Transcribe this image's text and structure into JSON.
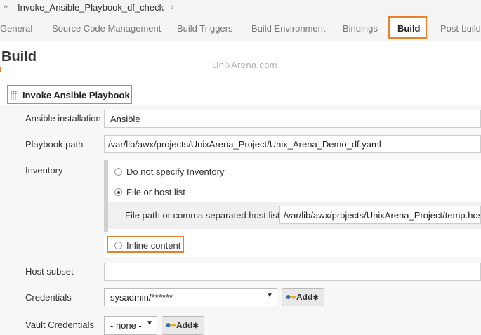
{
  "breadcrumb": {
    "separator": "»",
    "job_name": "Invoke_Ansible_Playbook_df_check",
    "chevron": "›"
  },
  "tabs": [
    {
      "label": "General",
      "active": false
    },
    {
      "label": "Source Code Management",
      "active": false
    },
    {
      "label": "Build Triggers",
      "active": false
    },
    {
      "label": "Build Environment",
      "active": false
    },
    {
      "label": "Bindings",
      "active": false
    },
    {
      "label": "Build",
      "active": true
    },
    {
      "label": "Post-build",
      "active": false
    }
  ],
  "page_title": "Build",
  "watermark": "UnixArena.com",
  "section": {
    "title": "Invoke Ansible Playbook"
  },
  "form": {
    "ansible_installation": {
      "label": "Ansible installation",
      "value": "Ansible"
    },
    "playbook_path": {
      "label": "Playbook path",
      "value": "/var/lib/awx/projects/UnixArena_Project/Unix_Arena_Demo_df.yaml"
    },
    "inventory": {
      "label": "Inventory",
      "options": [
        {
          "label": "Do not specify Inventory",
          "selected": false
        },
        {
          "label": "File or host list",
          "selected": true
        },
        {
          "label": "Inline content",
          "selected": false
        }
      ],
      "file_path_label": "File path or comma separated host list",
      "file_path_value": "/var/lib/awx/projects/UnixArena_Project/temp.hosts"
    },
    "host_subset": {
      "label": "Host subset",
      "value": ""
    },
    "credentials": {
      "label": "Credentials",
      "value": "sysadmin/******",
      "add_label": "Add"
    },
    "vault_credentials": {
      "label": "Vault Credentials",
      "value": "- none -",
      "add_label": "Add"
    }
  },
  "colors": {
    "highlight": "#e8822a",
    "tab_bar": "#f5f5f5",
    "section_bg": "#f7f7f7"
  }
}
